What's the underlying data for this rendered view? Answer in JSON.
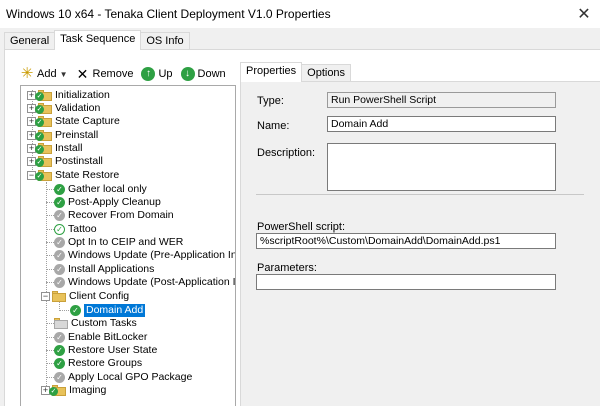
{
  "window": {
    "title": "Windows 10 x64 - Tenaka Client Deployment V1.0 Properties",
    "close_glyph": "✕"
  },
  "tabs": [
    {
      "label": "General"
    },
    {
      "label": "Task Sequence"
    },
    {
      "label": "OS Info"
    }
  ],
  "toolbar": {
    "add_label": "Add",
    "remove_label": "Remove",
    "up_label": "Up",
    "down_label": "Down"
  },
  "tree": {
    "items": [
      {
        "label": "Initialization"
      },
      {
        "label": "Validation"
      },
      {
        "label": "State Capture"
      },
      {
        "label": "Preinstall"
      },
      {
        "label": "Install"
      },
      {
        "label": "Postinstall"
      },
      {
        "label": "State Restore"
      },
      {
        "label": "Gather local only"
      },
      {
        "label": "Post-Apply Cleanup"
      },
      {
        "label": "Recover From Domain"
      },
      {
        "label": "Tattoo"
      },
      {
        "label": "Opt In to CEIP and WER"
      },
      {
        "label": "Windows Update (Pre-Application Installa"
      },
      {
        "label": "Install Applications"
      },
      {
        "label": "Windows Update (Post-Application Install"
      },
      {
        "label": "Client Config"
      },
      {
        "label": "Domain Add"
      },
      {
        "label": "Custom Tasks"
      },
      {
        "label": "Enable BitLocker"
      },
      {
        "label": "Restore User State"
      },
      {
        "label": "Restore Groups"
      },
      {
        "label": "Apply Local GPO Package"
      },
      {
        "label": "Imaging"
      }
    ]
  },
  "inner_tabs": [
    {
      "label": "Properties"
    },
    {
      "label": "Options"
    }
  ],
  "properties": {
    "type_label": "Type:",
    "type_value": "Run PowerShell Script",
    "name_label": "Name:",
    "name_value": "Domain Add",
    "description_label": "Description:",
    "description_value": "",
    "script_label": "PowerShell script:",
    "script_value": "%scriptRoot%\\Custom\\DomainAdd\\DomainAdd.ps1",
    "parameters_label": "Parameters:",
    "parameters_value": ""
  },
  "colors": {
    "accent": "#0078d7",
    "success": "#2ea043",
    "folder": "#e8c25a"
  }
}
